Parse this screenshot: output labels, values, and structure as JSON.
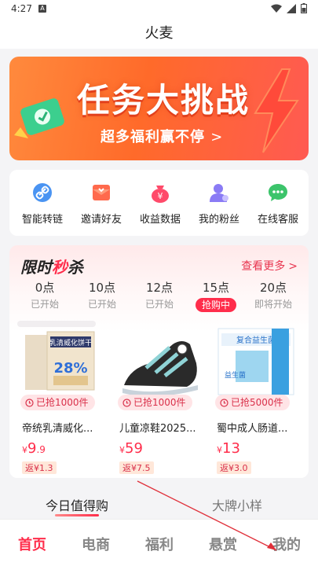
{
  "status_bar": {
    "time": "4:27",
    "notif": "A"
  },
  "header": {
    "title": "火麦"
  },
  "banner": {
    "title": "任务大挑战",
    "subtitle": "超多福利赢不停",
    "subtitle_arrow": ">"
  },
  "quick_actions": [
    {
      "label": "智能转链",
      "icon": "link-icon",
      "color": "#3d8cf0"
    },
    {
      "label": "邀请好友",
      "icon": "invite-envelope-icon",
      "color": "#ff6a4d"
    },
    {
      "label": "收益数据",
      "icon": "yuan-bag-icon",
      "color": "#ff4a6a"
    },
    {
      "label": "我的粉丝",
      "icon": "user-icon",
      "color": "#8a7bf5"
    },
    {
      "label": "在线客服",
      "icon": "chat-icon",
      "color": "#3cc46b"
    }
  ],
  "flash_sale": {
    "title_prefix": "限时",
    "title_accent": "秒",
    "title_suffix": "杀",
    "more_label": "查看更多",
    "more_chevron": ">",
    "slots": [
      {
        "time": "0点",
        "status": "已开始"
      },
      {
        "time": "10点",
        "status": "已开始"
      },
      {
        "time": "12点",
        "status": "已开始"
      },
      {
        "time": "15点",
        "status": "抢购中",
        "active": true
      },
      {
        "time": "20点",
        "status": "即将开始"
      }
    ],
    "products": [
      {
        "sold": "已抢1000件",
        "name": "帝统乳清威化...",
        "yen": "¥",
        "price_int": "9",
        "price_dec": ".9",
        "rebate": "返¥1.3"
      },
      {
        "sold": "已抢1000件",
        "name": "儿童凉鞋2025...",
        "yen": "¥",
        "price_int": "59",
        "price_dec": "",
        "rebate": "返¥7.5"
      },
      {
        "sold": "已抢5000件",
        "name": "蜀中成人肠道...",
        "yen": "¥",
        "price_int": "13",
        "price_dec": "",
        "rebate": "返¥3.0"
      }
    ],
    "product_images": {
      "p1_text": "28%",
      "p1_brand": "乳清威化饼干",
      "p3_brand": "复合益生菌",
      "p3_side": "益生菌"
    }
  },
  "tabs": {
    "active": "今日值得购",
    "inactive": "大牌小样"
  },
  "bottom_nav": [
    {
      "label": "首页",
      "active": true
    },
    {
      "label": "电商"
    },
    {
      "label": "福利"
    },
    {
      "label": "悬赏"
    },
    {
      "label": "我的"
    }
  ],
  "colors": {
    "accent": "#ff2d4b",
    "banner": "#ff6a2a"
  }
}
